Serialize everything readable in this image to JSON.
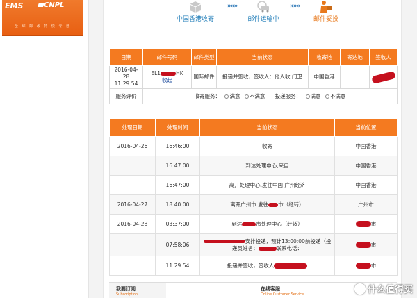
{
  "brand": {
    "ems": "EMS",
    "cnp": "CNPL",
    "tagline": "全 球 邮 政 特 快 专 递"
  },
  "progress": {
    "steps": [
      {
        "label": "中国香港收寄",
        "icon": "box-icon"
      },
      {
        "label": "邮件运输中",
        "icon": "truck-icon"
      },
      {
        "label": "邮件妥投",
        "icon": "delivery-person-icon"
      }
    ],
    "arrow": "»»»"
  },
  "summary": {
    "headers": [
      "日期",
      "邮件号码",
      "邮件类型",
      "当前状态",
      "收寄地",
      "寄达地",
      "签收人"
    ],
    "row": {
      "date": "2016-04-28 11:29:54",
      "mail_no": "EL1",
      "mail_suffix": "HK",
      "collapse": "收起",
      "type": "国际邮件",
      "status": "投递并签收，签收人：他人收 门卫",
      "origin": "中国香港",
      "dest": "",
      "signer": ""
    },
    "rating": {
      "label": "服务评价",
      "collect_label": "收寄服务：",
      "deliver_label": "投递服务：",
      "satisfied": "满意",
      "unsatisfied": "不满意"
    }
  },
  "tracking": {
    "headers": [
      "处理日期",
      "处理时间",
      "当前状态",
      "当前位置"
    ],
    "rows": [
      {
        "date": "2016-04-26",
        "time": "16:46:00",
        "status": "收寄",
        "location": "中国香港"
      },
      {
        "date": "",
        "time": "16:47:00",
        "status": "到达处理中心,来自",
        "location": "中国香港"
      },
      {
        "date": "",
        "time": "16:47:00",
        "status": "离开处理中心,发往中国 广州经济",
        "location": "中国香港"
      },
      {
        "date": "2016-04-27",
        "time": "18:40:00",
        "status": "离开广州市 发往",
        "status2": "市（经转）",
        "location": "广州市"
      },
      {
        "date": "2016-04-28",
        "time": "03:37:00",
        "status": "到达",
        "status2": "市处理中心（经转）",
        "location": "市"
      },
      {
        "date": "",
        "time": "07:58:06",
        "status": "安排投递，预计13:00:00前投递（投递员姓名：",
        "status2": "联系电话：",
        "location": "市"
      },
      {
        "date": "",
        "time": "11:29:54",
        "status": "投递并签收，签收人",
        "location": "市"
      }
    ]
  },
  "bottom": {
    "subscribe_title": "我要订阅",
    "subscribe_sub": "Subscription",
    "service_title": "在线客服",
    "service_sub": "Online Customer Service"
  },
  "watermark": "什么值得买",
  "colors": {
    "accent": "#f47a20",
    "link": "#1b7ab7",
    "redact": "#c5101e"
  }
}
